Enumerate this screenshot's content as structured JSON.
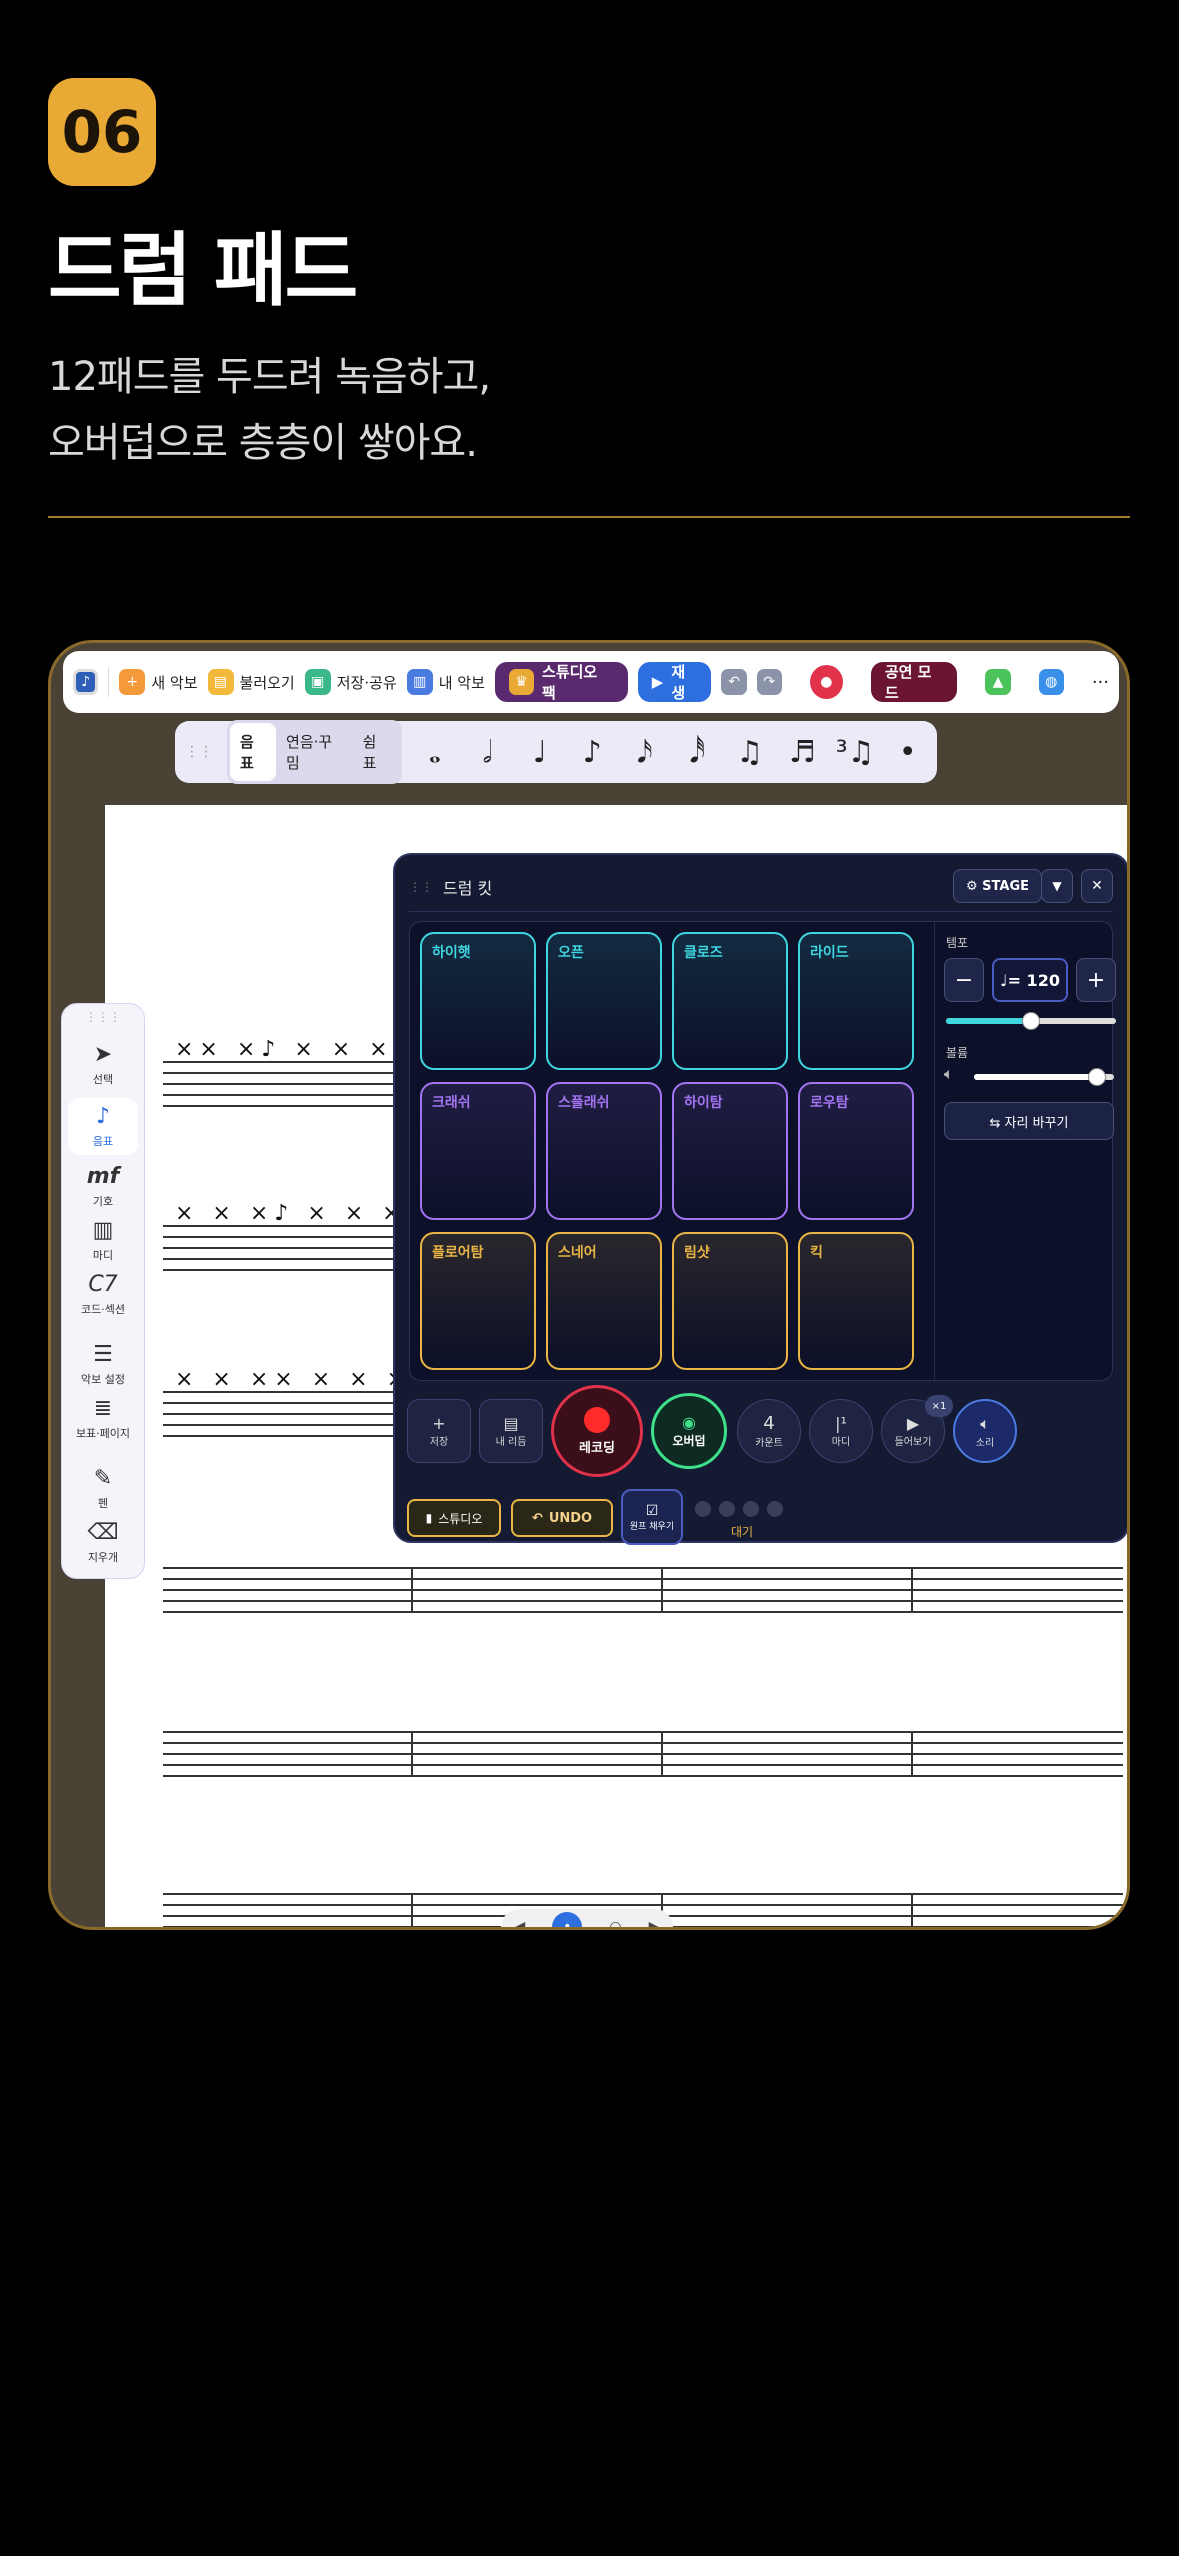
{
  "header": {
    "badge": "06",
    "title": "드럼 패드",
    "subtitle_line1": "12패드를 두드려 녹음하고,",
    "subtitle_line2": "오버덥으로 층층이 쌓아요."
  },
  "toolbar": {
    "new": "새 악보",
    "load": "불러오기",
    "save": "저장·공유",
    "my": "내 악보",
    "studio": "스튜디오 팩",
    "play": "재생",
    "perform": "공연 모드",
    "more": "···"
  },
  "notebar": {
    "tabs": [
      "음표",
      "연음·꾸밈",
      "쉼표"
    ],
    "active": "음표"
  },
  "sidebar": {
    "items": [
      {
        "label": "선택",
        "icon": "pointer-icon"
      },
      {
        "label": "음표",
        "icon": "note-icon"
      },
      {
        "label": "기호",
        "icon": "dynamics-icon"
      },
      {
        "label": "마디",
        "icon": "measure-icon"
      },
      {
        "label": "코드·섹션",
        "icon": "chord-icon"
      },
      {
        "label": "악보 설정",
        "icon": "score-settings-icon"
      },
      {
        "label": "보표·페이지",
        "icon": "staff-page-icon"
      },
      {
        "label": "펜",
        "icon": "pen-icon"
      },
      {
        "label": "지우개",
        "icon": "eraser-icon"
      }
    ]
  },
  "drumkit": {
    "title": "드럼 킷",
    "stage": "⚙ STAGE",
    "pads": [
      {
        "label": "하이햇",
        "color": "#3fd6e0"
      },
      {
        "label": "오픈",
        "color": "#3fd6e0"
      },
      {
        "label": "클로즈",
        "color": "#3fd6e0"
      },
      {
        "label": "라이드",
        "color": "#3fd6e0"
      },
      {
        "label": "크래쉬",
        "color": "#a274f0"
      },
      {
        "label": "스플래쉬",
        "color": "#a274f0"
      },
      {
        "label": "하이탐",
        "color": "#a274f0"
      },
      {
        "label": "로우탐",
        "color": "#a274f0"
      },
      {
        "label": "플로어탐",
        "color": "#e9b545"
      },
      {
        "label": "스네어",
        "color": "#e9b545"
      },
      {
        "label": "림샷",
        "color": "#e9b545"
      },
      {
        "label": "킥",
        "color": "#e9b545"
      }
    ],
    "tempo_label": "템포",
    "tempo_value": "♩= 120",
    "tempo_level": 0.5,
    "volume_label": "볼륨",
    "volume_level": 0.88,
    "swap": "⇆ 자리 바꾸기",
    "controls": {
      "save": "저장",
      "myrhythm": "내 리듬",
      "record": "레코딩",
      "overdub": "오버덥",
      "count_num": "4",
      "count": "카운트",
      "measure": "마디",
      "playback": "들어보기",
      "loop": "×1",
      "sound": "소리"
    },
    "bottom": {
      "studio": "스튜디오",
      "undo": "UNDO",
      "metronome": "원프 채우기",
      "status": "대기"
    }
  }
}
